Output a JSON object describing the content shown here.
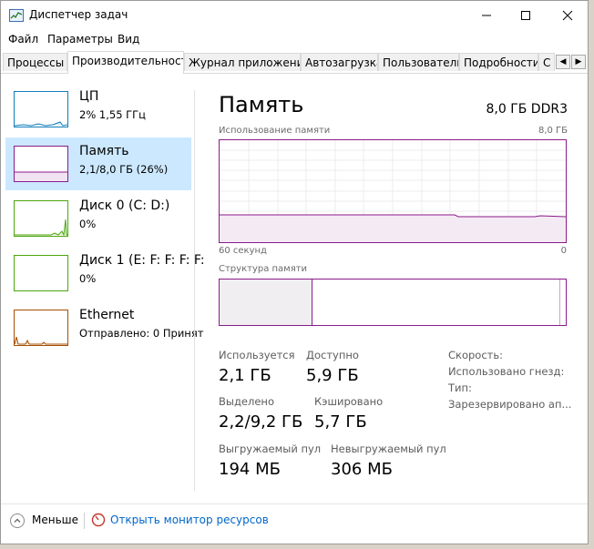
{
  "window": {
    "title": "Диспетчер задач"
  },
  "menu": [
    "Файл",
    "Параметры",
    "Вид"
  ],
  "tabs": [
    {
      "label": "Процессы"
    },
    {
      "label": "Производительность"
    },
    {
      "label": "Журнал приложений"
    },
    {
      "label": "Автозагрузка"
    },
    {
      "label": "Пользователи"
    },
    {
      "label": "Подробности"
    },
    {
      "label": "С"
    }
  ],
  "resources": [
    {
      "name": "ЦП",
      "sub": "2% 1,55 ГГц",
      "color": "#117dbb",
      "selected": false,
      "level": 0.02
    },
    {
      "name": "Память",
      "sub": "2,1/8,0 ГБ (26%)",
      "color": "#8b1a8b",
      "selected": true,
      "level": 0.26
    },
    {
      "name": "Диск 0 (C: D:)",
      "sub": "0%",
      "color": "#4da60c",
      "selected": false,
      "level": 0
    },
    {
      "name": "Диск 1 (E: F: F: F: F:",
      "sub": "0%",
      "color": "#4da60c",
      "selected": false,
      "level": 0
    },
    {
      "name": "Ethernet",
      "sub": "Отправлено: 0 Принят",
      "color": "#a74f01",
      "selected": false,
      "level": 0
    }
  ],
  "memory": {
    "title": "Память",
    "spec": "8,0 ГБ DDR3",
    "usage_label": "Использование памяти",
    "usage_max": "8,0 ГБ",
    "time_left": "60 секунд",
    "time_right": "0",
    "structure_label": "Структура памяти",
    "used_label": "Используется",
    "used_value": "2,1 ГБ",
    "avail_label": "Доступно",
    "avail_value": "5,9 ГБ",
    "committed_label": "Выделено",
    "committed_value": "2,2/9,2 ГБ",
    "cached_label": "Кэшировано",
    "cached_value": "5,7 ГБ",
    "paged_label": "Выгружаемый пул",
    "paged_value": "194 МБ",
    "nonpaged_label": "Невыгружаемый пул",
    "nonpaged_value": "306 МБ",
    "speed_label": "Скорость:",
    "slots_label": "Использовано гнезд:",
    "form_label": "Тип:",
    "reserved_label": "Зарезервировано ап..."
  },
  "footer": {
    "less_label": "Меньше",
    "monitor_link": "Открыть монитор ресурсов"
  },
  "colors": {
    "memory": "#8b1a8b",
    "cpu": "#117dbb",
    "disk": "#4da60c",
    "ethernet": "#a74f01",
    "selection": "#cce8ff",
    "link": "#0066cc"
  }
}
